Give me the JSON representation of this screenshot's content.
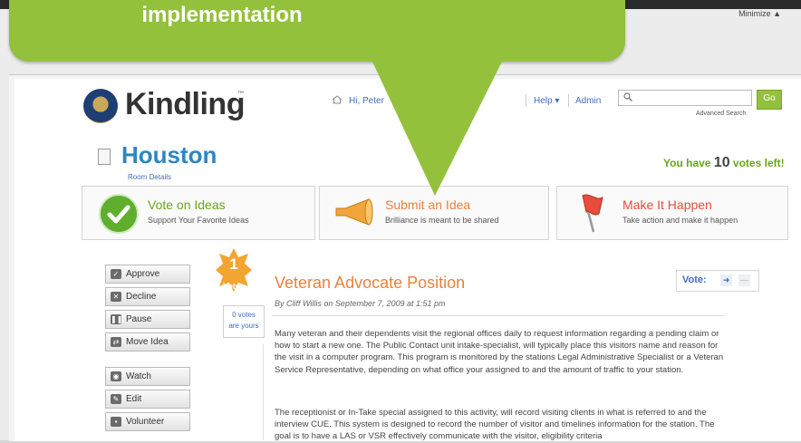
{
  "callout": {
    "text": "implementation"
  },
  "window": {
    "minimize_label": "Minimize ▲"
  },
  "header": {
    "logo_text": "Kindling",
    "logo_tm": "™",
    "greeting": "Hi, Peter",
    "help_label": "Help ▾",
    "admin_label": "Admin",
    "search_placeholder": "",
    "go_label": "Go",
    "advanced_search": "Advanced Search"
  },
  "room": {
    "title": "Houston",
    "details_link": "Room Details",
    "votes_prefix": "You have ",
    "votes_count": "10",
    "votes_suffix": " votes left!"
  },
  "features": [
    {
      "title": "Vote on Ideas",
      "subtitle": "Support Your Favorite Ideas"
    },
    {
      "title": "Submit an Idea",
      "subtitle": "Brilliance is meant to be shared"
    },
    {
      "title": "Make It Happen",
      "subtitle": "Take action and make it happen"
    }
  ],
  "actions": [
    {
      "label": "Approve",
      "icon": "check-icon"
    },
    {
      "label": "Decline",
      "icon": "x-icon"
    },
    {
      "label": "Pause",
      "icon": "pause-icon"
    },
    {
      "label": "Move Idea",
      "icon": "move-icon"
    },
    {
      "label": "Watch",
      "icon": "watch-icon"
    },
    {
      "label": "Edit",
      "icon": "edit-icon"
    },
    {
      "label": "Volunteer",
      "icon": "volunteer-icon"
    }
  ],
  "idea": {
    "vote_count": "1",
    "vote_word": "Votes",
    "yours_line1": "0 votes",
    "yours_line2": "are yours",
    "title": "Veteran Advocate Position",
    "byline": "By Cliff Willis on September 7, 2009 at 1:51 pm",
    "vote_label": "Vote:",
    "paragraph1": "Many veteran and their dependents visit the regional offices daily to request information regarding a pending claim or how to start a new one. The Public Contact unit intake-specialist, will typically place this visitors name and reason for the visit in a computer program. This program is monitored by the stations Legal Administrative Specialist or a Veteran Service Representative, depending on what office your assigned to and the amount of traffic to your station.",
    "paragraph2": "The receptionist or In-Take special assigned to this activity, will record visiting clients in what is referred to and the interview CUE. This system is designed to record the number of visitor and timelines information for the station. The goal is to have a LAS or VSR effectively communicate with the visitor, eligibility criteria"
  },
  "colors": {
    "accent_green": "#93c13b",
    "link_blue": "#3f6ebf",
    "title_orange": "#e8823c",
    "room_blue": "#2e86c1"
  }
}
